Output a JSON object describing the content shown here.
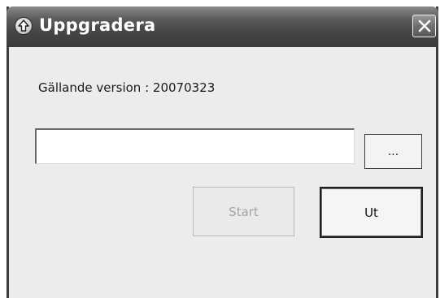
{
  "window": {
    "title": "Uppgradera",
    "icon": "upgrade-arrow-icon",
    "close_icon": "close-icon"
  },
  "main": {
    "version_label": "Gällande version : 20070323",
    "path_input": {
      "value": "",
      "placeholder": ""
    },
    "browse_label": "...",
    "start_label": "Start",
    "exit_label": "Ut"
  },
  "colors": {
    "titlebar": "#474747",
    "dialog_background": "#ececec",
    "disabled_text": "#a4a4a4"
  }
}
